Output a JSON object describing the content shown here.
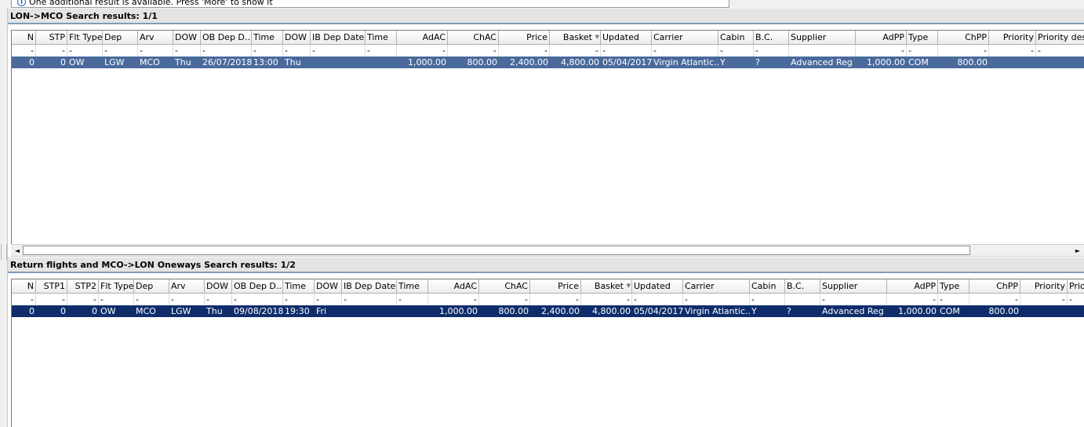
{
  "notice": {
    "text": "One additional result is available. Press 'More' to show it"
  },
  "outbound": {
    "title": "LON->MCO Search results: 1/1",
    "columns": [
      {
        "label": "N",
        "w": 31,
        "align": "r"
      },
      {
        "label": "STP",
        "w": 40,
        "align": "r"
      },
      {
        "label": "Flt Type",
        "w": 45,
        "align": "l"
      },
      {
        "label": "Dep",
        "w": 45,
        "align": "l"
      },
      {
        "label": "Arv",
        "w": 45,
        "align": "l"
      },
      {
        "label": "DOW",
        "w": 35,
        "align": "l"
      },
      {
        "label": "OB Dep D...",
        "w": 65,
        "align": "l"
      },
      {
        "label": "Time",
        "w": 40,
        "align": "l"
      },
      {
        "label": "DOW",
        "w": 35,
        "align": "l"
      },
      {
        "label": "IB Dep Date",
        "w": 70,
        "align": "l"
      },
      {
        "label": "Time",
        "w": 40,
        "align": "l"
      },
      {
        "label": "AdAC",
        "w": 65,
        "align": "r"
      },
      {
        "label": "ChAC",
        "w": 65,
        "align": "r"
      },
      {
        "label": "Price",
        "w": 65,
        "align": "r"
      },
      {
        "label": "Basket",
        "w": 65,
        "align": "r",
        "sort": true
      },
      {
        "label": "Updated",
        "w": 65,
        "align": "l"
      },
      {
        "label": "Carrier",
        "w": 85,
        "align": "l"
      },
      {
        "label": "Cabin",
        "w": 45,
        "align": "l"
      },
      {
        "label": "B.C.",
        "w": 45,
        "align": "l"
      },
      {
        "label": "Supplier",
        "w": 85,
        "align": "l"
      },
      {
        "label": "AdPP",
        "w": 65,
        "align": "r"
      },
      {
        "label": "Type",
        "w": 40,
        "align": "l"
      },
      {
        "label": "ChPP",
        "w": 65,
        "align": "r"
      },
      {
        "label": "Priority",
        "w": 60,
        "align": "r"
      },
      {
        "label": "Priority desc",
        "w": 65,
        "align": "l"
      }
    ],
    "filters": [
      "-",
      "-",
      "-",
      "-",
      "-",
      "-",
      "-",
      "-",
      "-",
      "-",
      "-",
      "-",
      "-",
      "-",
      "-",
      "-",
      "-",
      "-",
      "-",
      "",
      "-",
      "-",
      "-",
      "-",
      "-"
    ],
    "rows": [
      [
        "0",
        "0",
        "OW",
        "LGW",
        "MCO",
        "Thu",
        "26/07/2018",
        "13:00",
        "Thu",
        "",
        "",
        "1,000.00",
        "800.00",
        "2,400.00",
        "4,800.00",
        "05/04/2017",
        "Virgin Atlantic...",
        "Y",
        "?",
        "Advanced Reg",
        "1,000.00",
        "COM",
        "800.00",
        "",
        ""
      ]
    ]
  },
  "inbound": {
    "title": "Return flights and MCO->LON Oneways Search results: 1/2",
    "columns": [
      {
        "label": "N",
        "w": 31,
        "align": "r"
      },
      {
        "label": "STP1",
        "w": 40,
        "align": "r"
      },
      {
        "label": "STP2",
        "w": 40,
        "align": "r"
      },
      {
        "label": "Flt Type",
        "w": 45,
        "align": "l"
      },
      {
        "label": "Dep",
        "w": 45,
        "align": "l"
      },
      {
        "label": "Arv",
        "w": 45,
        "align": "l"
      },
      {
        "label": "DOW",
        "w": 35,
        "align": "l"
      },
      {
        "label": "OB Dep D...",
        "w": 65,
        "align": "l"
      },
      {
        "label": "Time",
        "w": 40,
        "align": "l"
      },
      {
        "label": "DOW",
        "w": 35,
        "align": "l"
      },
      {
        "label": "IB Dep Date",
        "w": 70,
        "align": "l"
      },
      {
        "label": "Time",
        "w": 40,
        "align": "l"
      },
      {
        "label": "AdAC",
        "w": 65,
        "align": "r"
      },
      {
        "label": "ChAC",
        "w": 65,
        "align": "r"
      },
      {
        "label": "Price",
        "w": 65,
        "align": "r"
      },
      {
        "label": "Basket",
        "w": 65,
        "align": "r",
        "sort": true
      },
      {
        "label": "Updated",
        "w": 65,
        "align": "l"
      },
      {
        "label": "Carrier",
        "w": 85,
        "align": "l"
      },
      {
        "label": "Cabin",
        "w": 45,
        "align": "l"
      },
      {
        "label": "B.C.",
        "w": 45,
        "align": "l"
      },
      {
        "label": "Supplier",
        "w": 85,
        "align": "l"
      },
      {
        "label": "AdPP",
        "w": 65,
        "align": "r"
      },
      {
        "label": "Type",
        "w": 40,
        "align": "l"
      },
      {
        "label": "ChPP",
        "w": 65,
        "align": "r"
      },
      {
        "label": "Priority",
        "w": 60,
        "align": "r"
      },
      {
        "label": "Prior",
        "w": 65,
        "align": "l"
      }
    ],
    "filters": [
      "-",
      "-",
      "-",
      "-",
      "-",
      "-",
      "-",
      "-",
      "-",
      "-",
      "-",
      "-",
      "-",
      "-",
      "-",
      "-",
      "-",
      "-",
      "-",
      "",
      "-",
      "-",
      "-",
      "-",
      "-",
      "-"
    ],
    "rows": [
      [
        "0",
        "0",
        "0",
        "OW",
        "MCO",
        "LGW",
        "Thu",
        "09/08/2018",
        "19:30",
        "Fri",
        "",
        "",
        "1,000.00",
        "800.00",
        "2,400.00",
        "4,800.00",
        "05/04/2017",
        "Virgin Atlantic...",
        "Y",
        "?",
        "Advanced Reg",
        "1,000.00",
        "COM",
        "800.00",
        "",
        ""
      ]
    ]
  },
  "scrollbar": {
    "left_arrow": "◄",
    "right_arrow": "►"
  },
  "icons": {
    "info": "i",
    "sort": "▼"
  }
}
